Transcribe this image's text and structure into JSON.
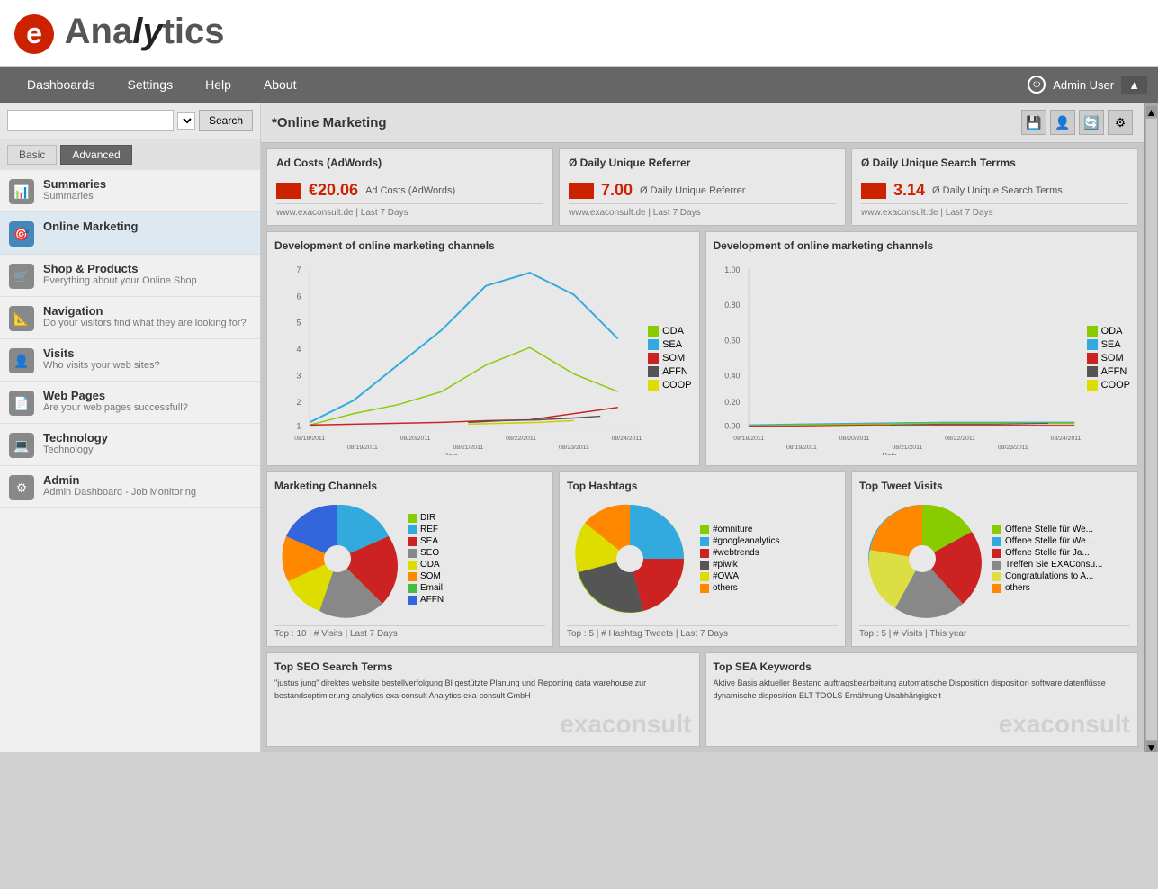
{
  "logo": {
    "e": "e",
    "text": "Analytics"
  },
  "nav": {
    "items": [
      {
        "label": "Dashboards",
        "id": "dashboards"
      },
      {
        "label": "Settings",
        "id": "settings"
      },
      {
        "label": "Help",
        "id": "help"
      },
      {
        "label": "About",
        "id": "about"
      }
    ],
    "user": "Admin User"
  },
  "sidebar": {
    "search_placeholder": "",
    "search_btn": "Search",
    "tab_basic": "Basic",
    "tab_advanced": "Advanced",
    "items": [
      {
        "id": "summaries",
        "icon": "📊",
        "title": "Summaries",
        "sub": "Summaries"
      },
      {
        "id": "online-marketing",
        "icon": "🎯",
        "title": "Online Marketing",
        "sub": ""
      },
      {
        "id": "shop-products",
        "icon": "🛒",
        "title": "Shop & Products",
        "sub": "Everything about your Online Shop"
      },
      {
        "id": "navigation",
        "icon": "📐",
        "title": "Navigation",
        "sub": "Do your visitors find what they are looking for?"
      },
      {
        "id": "visits",
        "icon": "👤",
        "title": "Visits",
        "sub": "Who visits your web sites?"
      },
      {
        "id": "web-pages",
        "icon": "📄",
        "title": "Web Pages",
        "sub": "Are your web pages successfull?"
      },
      {
        "id": "technology",
        "icon": "💻",
        "title": "Technology",
        "sub": "Technology"
      },
      {
        "id": "admin",
        "icon": "⚙",
        "title": "Admin",
        "sub": "Admin Dashboard - Job Monitoring"
      }
    ]
  },
  "page": {
    "title": "*Online Marketing"
  },
  "stats": [
    {
      "title": "Ad Costs (AdWords)",
      "value": "€20.06",
      "label": "Ad Costs (AdWords)",
      "site": "www.exaconsult.de",
      "period": "Last 7 Days"
    },
    {
      "title": "Ø Daily Unique Referrer",
      "value": "7.00",
      "label": "Ø Daily Unique Referrer",
      "site": "www.exaconsult.de",
      "period": "Last 7 Days"
    },
    {
      "title": "Ø Daily Unique Search Terrms",
      "value": "3.14",
      "label": "Ø Daily Unique Search Terms",
      "site": "www.exaconsult.de",
      "period": "Last 7 Days"
    }
  ],
  "charts": {
    "left": {
      "title": "Development of online marketing channels",
      "legend": [
        {
          "label": "ODA",
          "color": "#88cc00"
        },
        {
          "label": "SEA",
          "color": "#33aadd"
        },
        {
          "label": "SOM",
          "color": "#cc2222"
        },
        {
          "label": "AFFN",
          "color": "#555555"
        },
        {
          "label": "COOP",
          "color": "#dddd00"
        }
      ],
      "x_labels": [
        "08/18/2011",
        "08/19/2011",
        "08/20/2011",
        "08/21/2011",
        "08/22/2011",
        "08/23/2011",
        "08/24/2011"
      ],
      "y_max": 7
    },
    "right": {
      "title": "Development of online marketing channels",
      "legend": [
        {
          "label": "ODA",
          "color": "#88cc00"
        },
        {
          "label": "SEA",
          "color": "#33aadd"
        },
        {
          "label": "SOM",
          "color": "#cc2222"
        },
        {
          "label": "AFFN",
          "color": "#555555"
        },
        {
          "label": "COOP",
          "color": "#dddd00"
        }
      ],
      "y_max": 1.0
    }
  },
  "pie_charts": {
    "marketing": {
      "title": "Marketing Channels",
      "footer": "Top : 10  |  # Visits  |  Last 7 Days",
      "legend": [
        {
          "label": "DIR",
          "color": "#88cc00"
        },
        {
          "label": "REF",
          "color": "#33aadd"
        },
        {
          "label": "SEA",
          "color": "#cc2222"
        },
        {
          "label": "SEO",
          "color": "#888888"
        },
        {
          "label": "ODA",
          "color": "#dddd00"
        },
        {
          "label": "SOM",
          "color": "#ff8800"
        },
        {
          "label": "Email",
          "color": "#44bb44"
        },
        {
          "label": "AFFN",
          "color": "#3366dd"
        }
      ]
    },
    "hashtags": {
      "title": "Top Hashtags",
      "footer": "Top : 5  |  # Hashtag Tweets  |  Last 7 Days",
      "legend": [
        {
          "label": "#omniture",
          "color": "#88cc00"
        },
        {
          "label": "#googleanalytics",
          "color": "#33aadd"
        },
        {
          "label": "#webtrends",
          "color": "#cc2222"
        },
        {
          "label": "#piwik",
          "color": "#555555"
        },
        {
          "label": "#OWA",
          "color": "#dddd00"
        },
        {
          "label": "others",
          "color": "#ff8800"
        }
      ]
    },
    "tweets": {
      "title": "Top Tweet Visits",
      "footer": "Top : 5  |  # Visits  |  This year",
      "legend": [
        {
          "label": "Offene Stelle für We...",
          "color": "#88cc00"
        },
        {
          "label": "Offene Stelle für We...",
          "color": "#33aadd"
        },
        {
          "label": "Offene Stelle für Ja...",
          "color": "#cc2222"
        },
        {
          "label": "Treffen Sie EXAConsu...",
          "color": "#888888"
        },
        {
          "label": "Congratulations to A...",
          "color": "#dddd44"
        },
        {
          "label": "others",
          "color": "#ff8800"
        }
      ]
    }
  },
  "bottom": {
    "seo": {
      "title": "Top SEO Search Terms",
      "tags": "\"justus jung\" direktes website bestellverfolgung BI gestützte Planung und Reporting data warehouse zur bestandsoptimierung analytics exa-consult Analytics exa-consult GmbH",
      "watermark": "exaconsult"
    },
    "sea": {
      "title": "Top SEA Keywords",
      "tags": "Aktive Basis aktueller Bestand auftragsbearbeitung automatische Disposition disposition software datenflüsse dynamische disposition ELT TOOLS Ernährung Unabhängigkeit",
      "watermark": "exaconsult"
    }
  },
  "header_icons": {
    "save": "💾",
    "user": "👤",
    "refresh": "🔄",
    "settings": "⚙"
  }
}
